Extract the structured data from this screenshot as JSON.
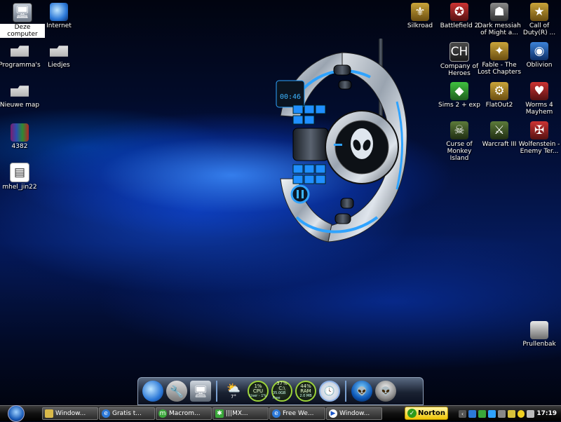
{
  "desktop_icons_left": [
    {
      "label": "Deze computer",
      "icon": "computer-icon",
      "selected": true
    },
    {
      "label": "Internet",
      "icon": "internet-explorer-icon"
    },
    {
      "label": "Programma's",
      "icon": "folder-icon"
    },
    {
      "label": "Liedjes",
      "icon": "folder-icon"
    },
    {
      "label": "Nieuwe map",
      "icon": "folder-icon"
    },
    {
      "label": "4382",
      "icon": "rar-archive-icon"
    },
    {
      "label": "mhel_jin22",
      "icon": "document-icon"
    }
  ],
  "desktop_icons_right": [
    {
      "label": "Silkroad",
      "icon": "silkroad-icon"
    },
    {
      "label": "Battlefield 2",
      "icon": "battlefield-icon"
    },
    {
      "label": "Dark messiah of Might a...",
      "icon": "dark-messiah-icon"
    },
    {
      "label": "Call of Duty(R) ...",
      "icon": "call-of-duty-icon"
    },
    {
      "label": "Company of Heroes",
      "icon": "company-of-heroes-icon"
    },
    {
      "label": "Fable - The Lost Chapters",
      "icon": "fable-icon"
    },
    {
      "label": "Oblivion",
      "icon": "oblivion-icon"
    },
    {
      "label": "Sims 2 + exp",
      "icon": "sims-icon"
    },
    {
      "label": "FlatOut2",
      "icon": "flatout-icon"
    },
    {
      "label": "Worms 4 Mayhem",
      "icon": "worms-icon"
    },
    {
      "label": "Curse of Monkey Island",
      "icon": "monkey-island-icon"
    },
    {
      "label": "Warcraft III",
      "icon": "warcraft-icon"
    },
    {
      "label": "Wolfenstein - Enemy Ter...",
      "icon": "wolfenstein-icon"
    },
    {
      "label": "Prullenbak",
      "icon": "recycle-bin-icon"
    }
  ],
  "gadget": {
    "time": "00:46",
    "icon": "alienware-media-player-icon"
  },
  "dock": {
    "cpu": {
      "label": "CPU",
      "value": "1%",
      "sub": "User - 1%"
    },
    "hd": {
      "label": "C:\\",
      "value": "37%",
      "sub": "35.0GB Free"
    },
    "ram": {
      "label": "RAM",
      "value": "44%",
      "sub": "2.0 MB"
    },
    "weather_temp": "7°"
  },
  "taskbar": {
    "tasks": [
      {
        "label": "Window...",
        "icon": "folder-icon"
      },
      {
        "label": "Gratis t...",
        "icon": "internet-explorer-icon"
      },
      {
        "label": "Macrom...",
        "icon": "macromedia-icon"
      },
      {
        "label": "|||MX...",
        "icon": "chat-icon"
      },
      {
        "label": "Free We...",
        "icon": "internet-explorer-icon"
      },
      {
        "label": "Window...",
        "icon": "media-player-icon"
      }
    ],
    "norton_label": "Norton",
    "clock": "17:19"
  }
}
